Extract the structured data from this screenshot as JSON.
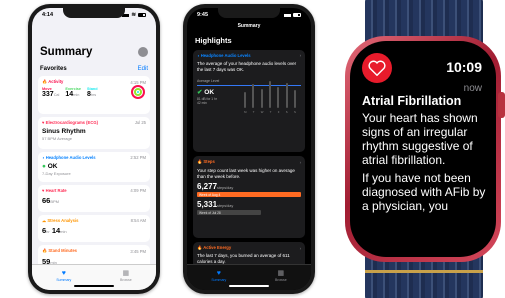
{
  "phone1": {
    "status": {
      "time": "4:14"
    },
    "title": "Summary",
    "favorites": {
      "heading": "Favorites",
      "edit": "Edit"
    },
    "activity": {
      "title": "Activity",
      "time": "4:15 PM",
      "move_label": "Move",
      "move_value": "337",
      "move_unit": "Cal",
      "exercise_label": "Exercise",
      "exercise_value": "14",
      "exercise_unit": "min",
      "stand_label": "Stand",
      "stand_value": "8",
      "stand_unit": "hrs"
    },
    "ecg": {
      "title": "Electrocardiograms (ECG)",
      "time": "Jul 25",
      "value": "Sinus Rhythm",
      "sub": "57 BPM Average"
    },
    "audio": {
      "title": "Headphone Audio Levels",
      "time": "2:52 PM",
      "value": "OK",
      "sub": "7-Day Exposure"
    },
    "heart": {
      "title": "Heart Rate",
      "time": "4:09 PM",
      "value": "66",
      "unit": "BPM"
    },
    "stress": {
      "title": "Stress Analysis",
      "time": "8:54 AM",
      "value_a": "6",
      "unit_a": "hr",
      "value_b": "14",
      "unit_b": "min"
    },
    "stand": {
      "title": "Stand Minutes",
      "time": "3:45 PM",
      "value": "59",
      "unit": "min"
    },
    "tabs": {
      "summary": "Summary",
      "browse": "Browse"
    }
  },
  "phone2": {
    "status": {
      "time": "9:45"
    },
    "nav_title": "Summary",
    "title": "Highlights",
    "audio": {
      "title": "Headphone Audio Levels",
      "text": "The average of your headphone audio levels over the last 7 days was OK.",
      "avg_label": "Average Level",
      "status": "OK",
      "sub1": "81 dB for 1 hr",
      "sub2": "42 min",
      "days": [
        "M",
        "T",
        "W",
        "T",
        "F",
        "S",
        "S"
      ]
    },
    "steps": {
      "title": "Steps",
      "text": "Your step count last week was higher on average than the week before.",
      "value1": "6,277",
      "unit1": "steps/day",
      "label1": "Week of Aug 4",
      "value2": "5,331",
      "unit2": "steps/day",
      "label2": "Week of Jul 28"
    },
    "energy": {
      "title": "Active Energy",
      "text": "The last 7 days, you burned an average of 611 calories a day."
    },
    "tabs": {
      "summary": "Summary",
      "browse": "Browse"
    }
  },
  "watch": {
    "time": "10:09",
    "when": "now",
    "title": "Atrial Fibrillation",
    "body1": "Your heart has shown signs of an irregular rhythm suggestive of atrial fibrillation.",
    "body2": "If you have not been diagnosed with AFib by a physician, you"
  },
  "colors": {
    "activity": "#fa114f",
    "ecg": "#ff2d55",
    "audio": "#0a84ff",
    "heart": "#ff2d55",
    "stress": "#ff9500",
    "stand": "#ff6b22",
    "ok": "#34c759",
    "steps_bar": "#ff6b22"
  },
  "audio_bars": [
    0.55,
    0.8,
    0.65,
    0.9,
    0.7,
    0.85,
    0.6
  ]
}
